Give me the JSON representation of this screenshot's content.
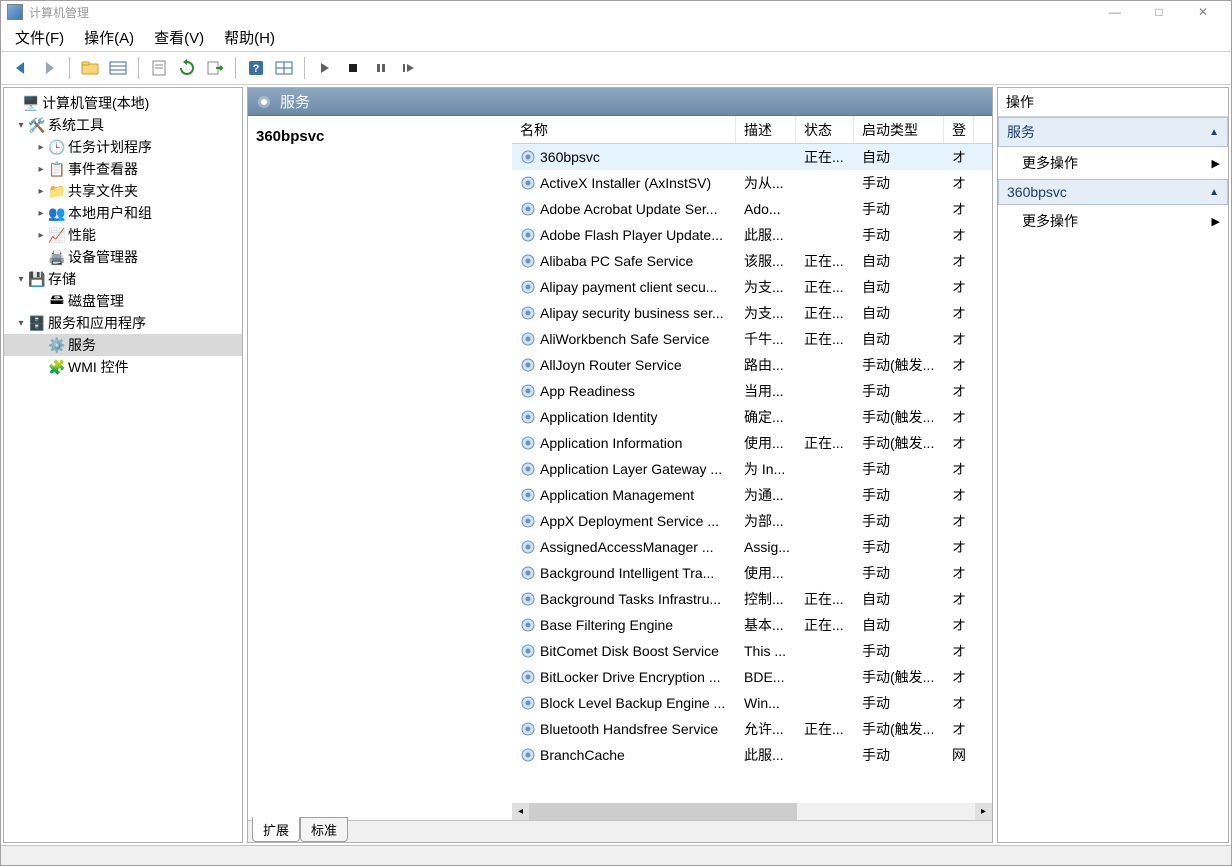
{
  "window": {
    "title": "计算机管理"
  },
  "window_controls": {
    "min": "—",
    "max": "□",
    "close": "✕"
  },
  "menu": {
    "file": "文件(F)",
    "action": "操作(A)",
    "view": "查看(V)",
    "help": "帮助(H)"
  },
  "tree": {
    "root": "计算机管理(本地)",
    "system_tools": "系统工具",
    "task_scheduler": "任务计划程序",
    "event_viewer": "事件查看器",
    "shared_folders": "共享文件夹",
    "local_users": "本地用户和组",
    "performance": "性能",
    "device_manager": "设备管理器",
    "storage": "存储",
    "disk_mgmt": "磁盘管理",
    "services_apps": "服务和应用程序",
    "services": "服务",
    "wmi": "WMI 控件"
  },
  "mid": {
    "header": "服务",
    "selection_title": "360bpsvc",
    "columns": {
      "name": "名称",
      "desc": "描述",
      "status": "状态",
      "startup": "启动类型",
      "logon": "登"
    },
    "rows": [
      {
        "name": "360bpsvc",
        "desc": "",
        "status": "正在...",
        "startup": "自动",
        "logon": "オ",
        "selected": true
      },
      {
        "name": "ActiveX Installer (AxInstSV)",
        "desc": "为从...",
        "status": "",
        "startup": "手动",
        "logon": "オ"
      },
      {
        "name": "Adobe Acrobat Update Ser...",
        "desc": "Ado...",
        "status": "",
        "startup": "手动",
        "logon": "オ"
      },
      {
        "name": "Adobe Flash Player Update...",
        "desc": "此服...",
        "status": "",
        "startup": "手动",
        "logon": "オ"
      },
      {
        "name": "Alibaba PC Safe Service",
        "desc": "该服...",
        "status": "正在...",
        "startup": "自动",
        "logon": "オ"
      },
      {
        "name": "Alipay payment client secu...",
        "desc": "为支...",
        "status": "正在...",
        "startup": "自动",
        "logon": "オ"
      },
      {
        "name": "Alipay security business ser...",
        "desc": "为支...",
        "status": "正在...",
        "startup": "自动",
        "logon": "オ"
      },
      {
        "name": "AliWorkbench Safe Service",
        "desc": "千牛...",
        "status": "正在...",
        "startup": "自动",
        "logon": "オ"
      },
      {
        "name": "AllJoyn Router Service",
        "desc": "路由...",
        "status": "",
        "startup": "手动(触发...",
        "logon": "オ"
      },
      {
        "name": "App Readiness",
        "desc": "当用...",
        "status": "",
        "startup": "手动",
        "logon": "オ"
      },
      {
        "name": "Application Identity",
        "desc": "确定...",
        "status": "",
        "startup": "手动(触发...",
        "logon": "オ"
      },
      {
        "name": "Application Information",
        "desc": "使用...",
        "status": "正在...",
        "startup": "手动(触发...",
        "logon": "オ"
      },
      {
        "name": "Application Layer Gateway ...",
        "desc": "为 In...",
        "status": "",
        "startup": "手动",
        "logon": "オ"
      },
      {
        "name": "Application Management",
        "desc": "为通...",
        "status": "",
        "startup": "手动",
        "logon": "オ"
      },
      {
        "name": "AppX Deployment Service ...",
        "desc": "为部...",
        "status": "",
        "startup": "手动",
        "logon": "オ"
      },
      {
        "name": "AssignedAccessManager ...",
        "desc": "Assig...",
        "status": "",
        "startup": "手动",
        "logon": "オ"
      },
      {
        "name": "Background Intelligent Tra...",
        "desc": "使用...",
        "status": "",
        "startup": "手动",
        "logon": "オ"
      },
      {
        "name": "Background Tasks Infrastru...",
        "desc": "控制...",
        "status": "正在...",
        "startup": "自动",
        "logon": "オ"
      },
      {
        "name": "Base Filtering Engine",
        "desc": "基本...",
        "status": "正在...",
        "startup": "自动",
        "logon": "オ"
      },
      {
        "name": "BitComet Disk Boost Service",
        "desc": "This ...",
        "status": "",
        "startup": "手动",
        "logon": "オ"
      },
      {
        "name": "BitLocker Drive Encryption ...",
        "desc": "BDE...",
        "status": "",
        "startup": "手动(触发...",
        "logon": "オ"
      },
      {
        "name": "Block Level Backup Engine ...",
        "desc": "Win...",
        "status": "",
        "startup": "手动",
        "logon": "オ"
      },
      {
        "name": "Bluetooth Handsfree Service",
        "desc": "允许...",
        "status": "正在...",
        "startup": "手动(触发...",
        "logon": "オ"
      },
      {
        "name": "BranchCache",
        "desc": "此服...",
        "status": "",
        "startup": "手动",
        "logon": "网"
      }
    ],
    "tabs": {
      "extended": "扩展",
      "standard": "标准"
    }
  },
  "right": {
    "title": "操作",
    "sections": [
      {
        "label": "服务"
      },
      {
        "label": "360bpsvc"
      }
    ],
    "more_actions": "更多操作"
  }
}
